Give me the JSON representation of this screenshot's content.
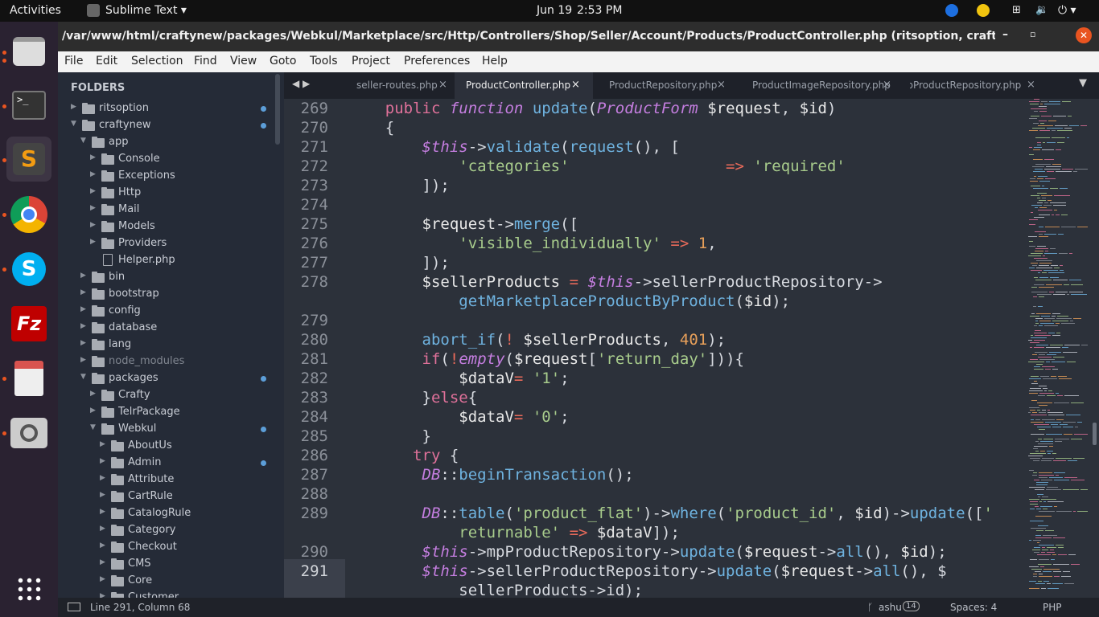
{
  "topbar": {
    "activities": "Activities",
    "app_name": "Sublime Text",
    "date": "Jun 19",
    "time": "2:53 PM"
  },
  "window": {
    "title": "/var/www/html/craftynew/packages/Webkul/Marketplace/src/Http/Controllers/Shop/Seller/Account/Products/ProductController.php (ritsoption, craftynew) - Subli..."
  },
  "menu": [
    "File",
    "Edit",
    "Selection",
    "Find",
    "View",
    "Goto",
    "Tools",
    "Project",
    "Preferences",
    "Help"
  ],
  "sidebar": {
    "heading": "FOLDERS",
    "items": [
      {
        "label": "ritsoption",
        "depth": 0,
        "expanded": false,
        "badge": true
      },
      {
        "label": "craftynew",
        "depth": 0,
        "expanded": true,
        "badge": true
      },
      {
        "label": "app",
        "depth": 1,
        "expanded": true,
        "badge": false
      },
      {
        "label": "Console",
        "depth": 2,
        "expanded": false,
        "badge": false
      },
      {
        "label": "Exceptions",
        "depth": 2,
        "expanded": false,
        "badge": false
      },
      {
        "label": "Http",
        "depth": 2,
        "expanded": false,
        "badge": false
      },
      {
        "label": "Mail",
        "depth": 2,
        "expanded": false,
        "badge": false
      },
      {
        "label": "Models",
        "depth": 2,
        "expanded": false,
        "badge": false
      },
      {
        "label": "Providers",
        "depth": 2,
        "expanded": false,
        "badge": false
      },
      {
        "label": "Helper.php",
        "depth": 2,
        "file": true,
        "badge": false
      },
      {
        "label": "bin",
        "depth": 1,
        "expanded": false,
        "badge": false
      },
      {
        "label": "bootstrap",
        "depth": 1,
        "expanded": false,
        "badge": false
      },
      {
        "label": "config",
        "depth": 1,
        "expanded": false,
        "badge": false
      },
      {
        "label": "database",
        "depth": 1,
        "expanded": false,
        "badge": false
      },
      {
        "label": "lang",
        "depth": 1,
        "expanded": false,
        "badge": false
      },
      {
        "label": "node_modules",
        "depth": 1,
        "expanded": false,
        "badge": false,
        "dim": true
      },
      {
        "label": "packages",
        "depth": 1,
        "expanded": true,
        "badge": true
      },
      {
        "label": "Crafty",
        "depth": 2,
        "expanded": false,
        "badge": false
      },
      {
        "label": "TelrPackage",
        "depth": 2,
        "expanded": false,
        "badge": false
      },
      {
        "label": "Webkul",
        "depth": 2,
        "expanded": true,
        "badge": true
      },
      {
        "label": "AboutUs",
        "depth": 3,
        "expanded": false,
        "badge": false
      },
      {
        "label": "Admin",
        "depth": 3,
        "expanded": false,
        "badge": true
      },
      {
        "label": "Attribute",
        "depth": 3,
        "expanded": false,
        "badge": false
      },
      {
        "label": "CartRule",
        "depth": 3,
        "expanded": false,
        "badge": false
      },
      {
        "label": "CatalogRule",
        "depth": 3,
        "expanded": false,
        "badge": false
      },
      {
        "label": "Category",
        "depth": 3,
        "expanded": false,
        "badge": false
      },
      {
        "label": "Checkout",
        "depth": 3,
        "expanded": false,
        "badge": false
      },
      {
        "label": "CMS",
        "depth": 3,
        "expanded": false,
        "badge": false
      },
      {
        "label": "Core",
        "depth": 3,
        "expanded": false,
        "badge": false
      },
      {
        "label": "Customer",
        "depth": 3,
        "expanded": false,
        "badge": false
      }
    ]
  },
  "tabs": [
    {
      "label": "seller-routes.php",
      "active": false
    },
    {
      "label": "ProductController.php",
      "active": true
    },
    {
      "label": "ProductRepository.php",
      "active": false
    },
    {
      "label": "ProductImageRepository.php",
      "active": false
    },
    {
      "label": "MpProductRepository.php",
      "active": false
    }
  ],
  "code": [
    {
      "n": "269",
      "t": [
        [
          "    ",
          ""
        ],
        [
          "public",
          "kw"
        ],
        [
          " ",
          ""
        ],
        [
          "function",
          "it"
        ],
        [
          " ",
          ""
        ],
        [
          "update",
          "fn"
        ],
        [
          "(",
          ""
        ],
        [
          "ProductForm",
          "it"
        ],
        [
          " ",
          ""
        ],
        [
          "$request",
          "var"
        ],
        [
          ", ",
          ""
        ],
        [
          "$id",
          "var"
        ],
        [
          ")",
          ""
        ]
      ]
    },
    {
      "n": "270",
      "t": [
        [
          "    {",
          ""
        ]
      ]
    },
    {
      "n": "271",
      "t": [
        [
          "        ",
          ""
        ],
        [
          "$this",
          "th"
        ],
        [
          "->",
          ""
        ],
        [
          "validate",
          "fn"
        ],
        [
          "(",
          ""
        ],
        [
          "request",
          "fn"
        ],
        [
          "(), [",
          ""
        ]
      ]
    },
    {
      "n": "272",
      "t": [
        [
          "            ",
          ""
        ],
        [
          "'categories'",
          "str"
        ],
        [
          "                 ",
          ""
        ],
        [
          "=>",
          "op"
        ],
        [
          " ",
          ""
        ],
        [
          "'required'",
          "str"
        ]
      ]
    },
    {
      "n": "273",
      "t": [
        [
          "        ]);",
          ""
        ]
      ]
    },
    {
      "n": "274",
      "t": []
    },
    {
      "n": "275",
      "t": [
        [
          "        ",
          ""
        ],
        [
          "$request",
          "var"
        ],
        [
          "->",
          ""
        ],
        [
          "merge",
          "fn"
        ],
        [
          "([",
          ""
        ]
      ]
    },
    {
      "n": "276",
      "t": [
        [
          "            ",
          ""
        ],
        [
          "'visible_individually'",
          "str"
        ],
        [
          " ",
          ""
        ],
        [
          "=>",
          "op"
        ],
        [
          " ",
          ""
        ],
        [
          "1",
          "num"
        ],
        [
          ",",
          ""
        ]
      ]
    },
    {
      "n": "277",
      "t": [
        [
          "        ]);",
          ""
        ]
      ]
    },
    {
      "n": "278",
      "t": [
        [
          "        ",
          ""
        ],
        [
          "$sellerProducts",
          "var"
        ],
        [
          " ",
          ""
        ],
        [
          "=",
          "op"
        ],
        [
          " ",
          ""
        ],
        [
          "$this",
          "th"
        ],
        [
          "->sellerProductRepository->",
          ""
        ]
      ]
    },
    {
      "n": "",
      "t": [
        [
          "            ",
          ""
        ],
        [
          "getMarketplaceProductByProduct",
          "fn"
        ],
        [
          "(",
          ""
        ],
        [
          "$id",
          "var"
        ],
        [
          ");",
          ""
        ]
      ]
    },
    {
      "n": "279",
      "t": []
    },
    {
      "n": "280",
      "t": [
        [
          "        ",
          ""
        ],
        [
          "abort_if",
          "fn"
        ],
        [
          "(",
          ""
        ],
        [
          "!",
          "op"
        ],
        [
          " ",
          ""
        ],
        [
          "$sellerProducts",
          "var"
        ],
        [
          ", ",
          ""
        ],
        [
          "401",
          "num"
        ],
        [
          ");",
          ""
        ]
      ]
    },
    {
      "n": "281",
      "t": [
        [
          "        ",
          ""
        ],
        [
          "if",
          "kw"
        ],
        [
          "(",
          ""
        ],
        [
          "!",
          "op"
        ],
        [
          "empty",
          "it"
        ],
        [
          "(",
          ""
        ],
        [
          "$request",
          "var"
        ],
        [
          "[",
          ""
        ],
        [
          "'return_day'",
          "str"
        ],
        [
          "])){",
          ""
        ]
      ]
    },
    {
      "n": "282",
      "t": [
        [
          "            ",
          ""
        ],
        [
          "$dataV",
          "var"
        ],
        [
          "=",
          "op"
        ],
        [
          " ",
          ""
        ],
        [
          "'1'",
          "str"
        ],
        [
          ";",
          ""
        ]
      ]
    },
    {
      "n": "283",
      "t": [
        [
          "        }",
          ""
        ],
        [
          "else",
          "kw"
        ],
        [
          "{",
          ""
        ]
      ]
    },
    {
      "n": "284",
      "t": [
        [
          "            ",
          ""
        ],
        [
          "$dataV",
          "var"
        ],
        [
          "=",
          "op"
        ],
        [
          " ",
          ""
        ],
        [
          "'0'",
          "str"
        ],
        [
          ";",
          ""
        ]
      ]
    },
    {
      "n": "285",
      "t": [
        [
          "        }",
          ""
        ]
      ]
    },
    {
      "n": "286",
      "t": [
        [
          "       ",
          ""
        ],
        [
          "try",
          "kw"
        ],
        [
          " {",
          ""
        ]
      ]
    },
    {
      "n": "287",
      "t": [
        [
          "        ",
          ""
        ],
        [
          "DB",
          "it"
        ],
        [
          "::",
          ""
        ],
        [
          "beginTransaction",
          "fn"
        ],
        [
          "();",
          ""
        ]
      ]
    },
    {
      "n": "288",
      "t": []
    },
    {
      "n": "289",
      "t": [
        [
          "        ",
          ""
        ],
        [
          "DB",
          "it"
        ],
        [
          "::",
          ""
        ],
        [
          "table",
          "fn"
        ],
        [
          "(",
          ""
        ],
        [
          "'product_flat'",
          "str"
        ],
        [
          ")->",
          ""
        ],
        [
          "where",
          "fn"
        ],
        [
          "(",
          ""
        ],
        [
          "'product_id'",
          "str"
        ],
        [
          ", ",
          ""
        ],
        [
          "$id",
          "var"
        ],
        [
          ")->",
          ""
        ],
        [
          "update",
          "fn"
        ],
        [
          "([",
          ""
        ],
        [
          "'",
          "str"
        ]
      ]
    },
    {
      "n": "",
      "t": [
        [
          "            ",
          ""
        ],
        [
          "returnable'",
          "str"
        ],
        [
          " ",
          ""
        ],
        [
          "=>",
          "op"
        ],
        [
          " ",
          ""
        ],
        [
          "$dataV",
          "var"
        ],
        [
          "]);",
          ""
        ]
      ]
    },
    {
      "n": "290",
      "t": [
        [
          "        ",
          ""
        ],
        [
          "$this",
          "th"
        ],
        [
          "->mpProductRepository->",
          ""
        ],
        [
          "update",
          "fn"
        ],
        [
          "(",
          ""
        ],
        [
          "$request",
          "var"
        ],
        [
          "->",
          ""
        ],
        [
          "all",
          "fn"
        ],
        [
          "(), ",
          ""
        ],
        [
          "$id",
          "var"
        ],
        [
          ");",
          ""
        ]
      ]
    },
    {
      "n": "291",
      "t": [
        [
          "        ",
          ""
        ],
        [
          "$this",
          "th"
        ],
        [
          "->sellerProductRepository->",
          ""
        ],
        [
          "update",
          "fn"
        ],
        [
          "(",
          ""
        ],
        [
          "$request",
          "var"
        ],
        [
          "->",
          ""
        ],
        [
          "all",
          "fn"
        ],
        [
          "(), $",
          ""
        ]
      ]
    },
    {
      "n": "",
      "t": [
        [
          "            sellerProducts->id);",
          ""
        ]
      ]
    }
  ],
  "colors": {
    "kw": "#e0719a",
    "it": "#c57ee0",
    "fn": "#6fb3e0",
    "var": "#e8e8e8",
    "str": "#a8cc8c",
    "num": "#e8a05a",
    "op": "#e86a5a",
    "th": "#c57ee0",
    "plain": "#d7dae0"
  },
  "statusbar": {
    "position": "Line 291, Column 68",
    "branch": "ashu",
    "branch_count": "14",
    "spaces": "Spaces: 4",
    "syntax": "PHP"
  },
  "dock_icons": [
    "files-icon",
    "terminal-icon",
    "sublime-text-icon",
    "chrome-icon",
    "skype-icon",
    "filezilla-icon",
    "document-viewer-icon",
    "image-viewer-icon",
    "app-grid-icon"
  ]
}
